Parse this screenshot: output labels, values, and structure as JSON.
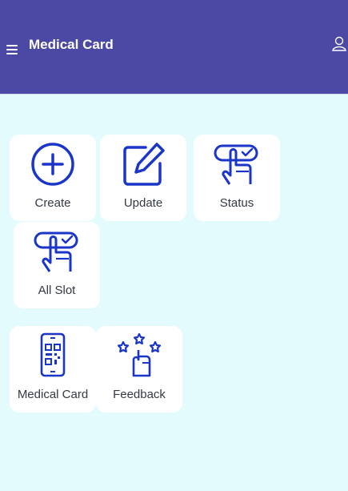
{
  "header": {
    "title": "Medical Card"
  },
  "icons": {
    "menu": "hamburger-menu-icon",
    "user": "user-profile-icon"
  },
  "colors": {
    "header_bg": "#4b49a4",
    "page_bg": "#e3fbfd",
    "icon_blue": "#1a35c8"
  },
  "tiles": {
    "create": {
      "label": "Create",
      "icon": "plus-circle-icon"
    },
    "update": {
      "label": "Update",
      "icon": "edit-icon"
    },
    "status": {
      "label": "Status",
      "icon": "hand-touch-check-icon"
    },
    "all_slot": {
      "label": "All Slot",
      "icon": "hand-touch-check-icon"
    },
    "medical_card": {
      "label": "Medical Card",
      "icon": "phone-qr-code-icon"
    },
    "feedback": {
      "label": "Feedback",
      "icon": "thumbs-up-stars-icon"
    }
  }
}
